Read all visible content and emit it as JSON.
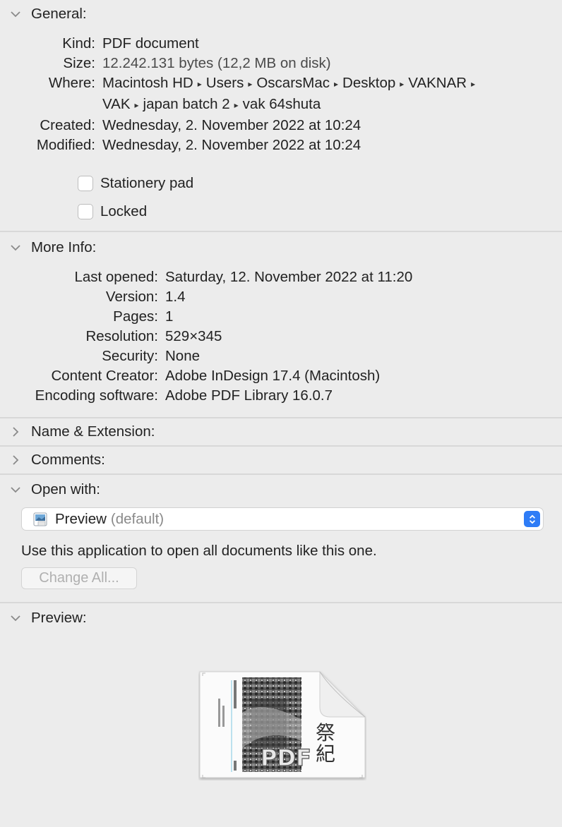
{
  "general": {
    "title": "General:",
    "rows": [
      {
        "key": "Kind:",
        "value": "PDF document"
      },
      {
        "key": "Size:",
        "value": "12.242.131 bytes (12,2 MB on disk)"
      },
      {
        "key": "Where:",
        "path": [
          "Macintosh HD",
          "Users",
          "OscarsMac",
          "Desktop",
          "VAKNAR",
          "VAK",
          "japan batch 2",
          "vak 64shuta"
        ]
      },
      {
        "key": "Created:",
        "value": "Wednesday, 2. November 2022 at 10:24"
      },
      {
        "key": "Modified:",
        "value": "Wednesday, 2. November 2022 at 10:24"
      }
    ],
    "stationery_label": "Stationery pad",
    "locked_label": "Locked",
    "stationery_checked": false,
    "locked_checked": false
  },
  "more_info": {
    "title": "More Info:",
    "rows": [
      {
        "key": "Last opened:",
        "value": "Saturday, 12. November 2022 at 11:20"
      },
      {
        "key": "Version:",
        "value": "1.4"
      },
      {
        "key": "Pages:",
        "value": "1"
      },
      {
        "key": "Resolution:",
        "value": "529×345"
      },
      {
        "key": "Security:",
        "value": "None"
      },
      {
        "key": "Content Creator:",
        "value": "Adobe InDesign 17.4 (Macintosh)"
      },
      {
        "key": "Encoding software:",
        "value": "Adobe PDF Library 16.0.7"
      }
    ]
  },
  "name_ext": {
    "title": "Name & Extension:"
  },
  "comments": {
    "title": "Comments:"
  },
  "open_with": {
    "title": "Open with:",
    "app_name": "Preview",
    "app_suffix": "(default)",
    "description": "Use this application to open all documents like this one.",
    "change_all_label": "Change All..."
  },
  "preview": {
    "title": "Preview:",
    "badge_text": "PDF"
  },
  "colors": {
    "accent": "#2e7cf6",
    "background": "#ececec"
  }
}
